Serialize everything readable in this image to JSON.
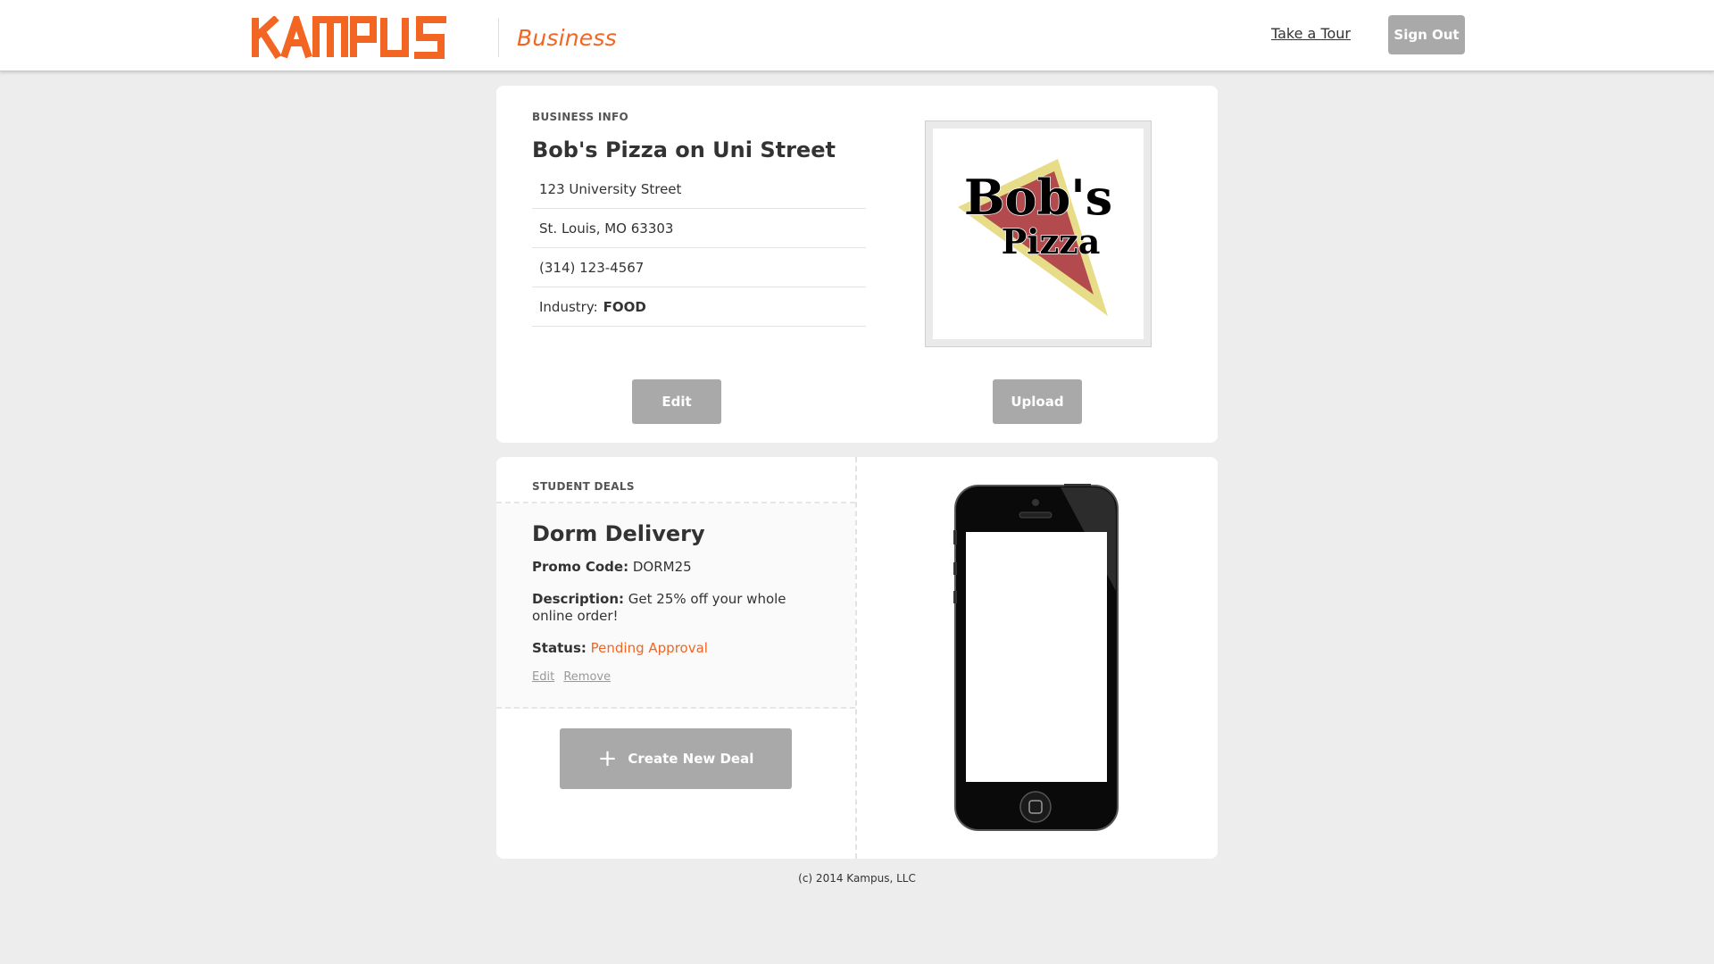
{
  "header": {
    "logo_text": "KAMPUS",
    "subtitle": "Business",
    "tour_link": "Take a Tour",
    "signout_label": "Sign Out"
  },
  "business_info": {
    "section_label": "BUSINESS INFO",
    "name": "Bob's Pizza on Uni Street",
    "address_line1": "123 University Street",
    "address_line2": "St. Louis, MO 63303",
    "phone": "(314) 123-4567",
    "industry_label": "Industry:",
    "industry_value": "FOOD",
    "logo_text_line1": "Bob's",
    "logo_text_line2": "Pizza",
    "edit_label": "Edit",
    "upload_label": "Upload"
  },
  "student_deals": {
    "section_label": "STUDENT DEALS",
    "deal": {
      "title": "Dorm Delivery",
      "promo_label": "Promo Code:",
      "promo_value": "DORM25",
      "description_label": "Description:",
      "description_value": "Get 25% off your whole online order!",
      "status_label": "Status:",
      "status_value": "Pending Approval",
      "edit_link": "Edit",
      "remove_link": "Remove"
    },
    "create_label": "Create New Deal"
  },
  "footer": {
    "copyright": "(c) 2014 Kampus, LLC"
  },
  "colors": {
    "brand_orange": "#f26522",
    "button_gray": "#a9a9a9",
    "page_bg": "#ededed"
  }
}
